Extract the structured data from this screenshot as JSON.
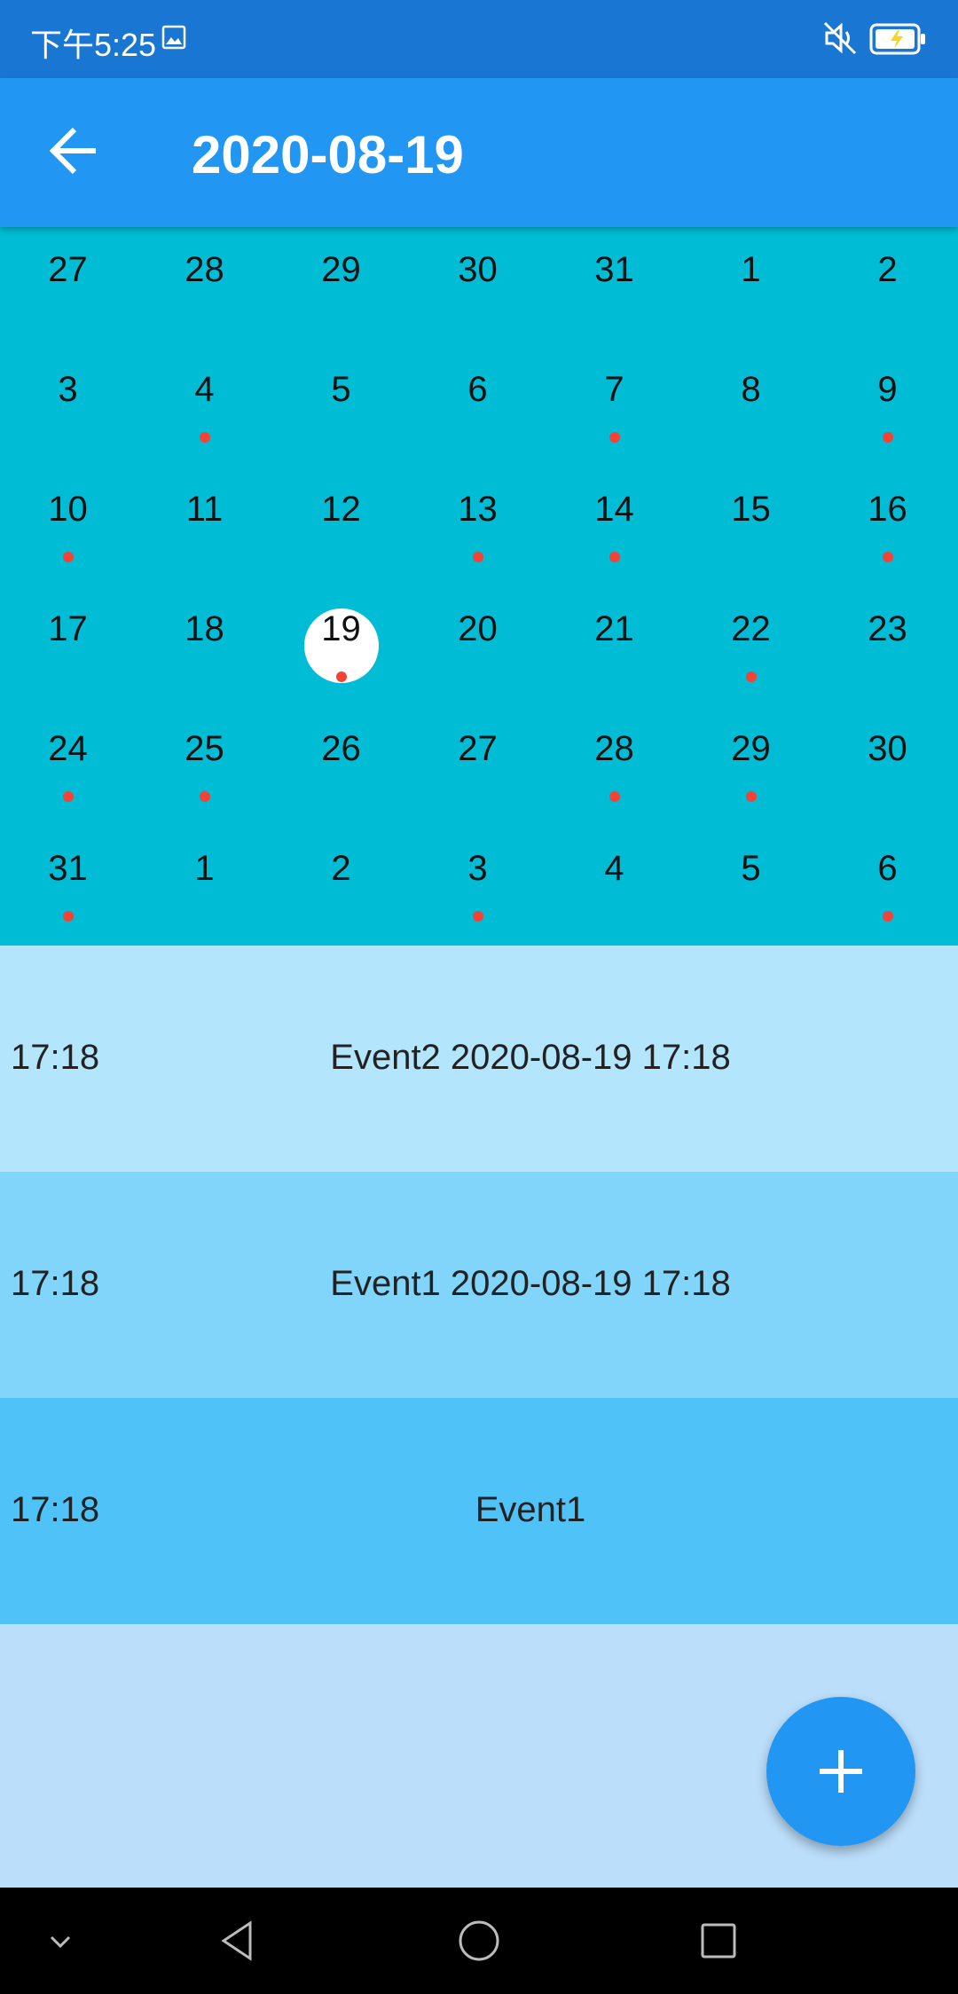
{
  "status_bar": {
    "time": "下午5:25",
    "icons": [
      "image-icon",
      "mute-icon",
      "battery-charging-icon"
    ]
  },
  "app_bar": {
    "back_icon": "arrow-back-icon",
    "title": "2020-08-19"
  },
  "calendar": {
    "weeks": [
      [
        {
          "day": "27"
        },
        {
          "day": "28"
        },
        {
          "day": "29"
        },
        {
          "day": "30"
        },
        {
          "day": "31"
        },
        {
          "day": "1"
        },
        {
          "day": "2"
        }
      ],
      [
        {
          "day": "3"
        },
        {
          "day": "4",
          "event": true
        },
        {
          "day": "5"
        },
        {
          "day": "6"
        },
        {
          "day": "7",
          "event": true
        },
        {
          "day": "8"
        },
        {
          "day": "9",
          "event": true
        }
      ],
      [
        {
          "day": "10",
          "event": true
        },
        {
          "day": "11"
        },
        {
          "day": "12"
        },
        {
          "day": "13",
          "event": true
        },
        {
          "day": "14",
          "event": true
        },
        {
          "day": "15"
        },
        {
          "day": "16",
          "event": true
        }
      ],
      [
        {
          "day": "17"
        },
        {
          "day": "18"
        },
        {
          "day": "19",
          "event": true,
          "selected": true
        },
        {
          "day": "20"
        },
        {
          "day": "21"
        },
        {
          "day": "22",
          "event": true
        },
        {
          "day": "23"
        }
      ],
      [
        {
          "day": "24",
          "event": true
        },
        {
          "day": "25",
          "event": true
        },
        {
          "day": "26"
        },
        {
          "day": "27"
        },
        {
          "day": "28",
          "event": true
        },
        {
          "day": "29",
          "event": true
        },
        {
          "day": "30"
        }
      ],
      [
        {
          "day": "31",
          "event": true
        },
        {
          "day": "1"
        },
        {
          "day": "2"
        },
        {
          "day": "3",
          "event": true
        },
        {
          "day": "4"
        },
        {
          "day": "5"
        },
        {
          "day": "6",
          "event": true
        }
      ]
    ],
    "colors": {
      "background": "#00bcd4",
      "event_dot": "#f44336",
      "selected": "#ffffff"
    }
  },
  "events": [
    {
      "time": "17:18",
      "title": "Event2 2020-08-19 17:18",
      "color": "#b3e5fc"
    },
    {
      "time": "17:18",
      "title": "Event1 2020-08-19 17:18",
      "color": "#81d4fa"
    },
    {
      "time": "17:18",
      "title": "Event1",
      "color": "#4fc3f7"
    }
  ],
  "fab": {
    "icon": "add-icon"
  },
  "nav_bar": {
    "icons": [
      "chevron-down-icon",
      "back-triangle-icon",
      "home-circle-icon",
      "recents-square-icon"
    ]
  }
}
